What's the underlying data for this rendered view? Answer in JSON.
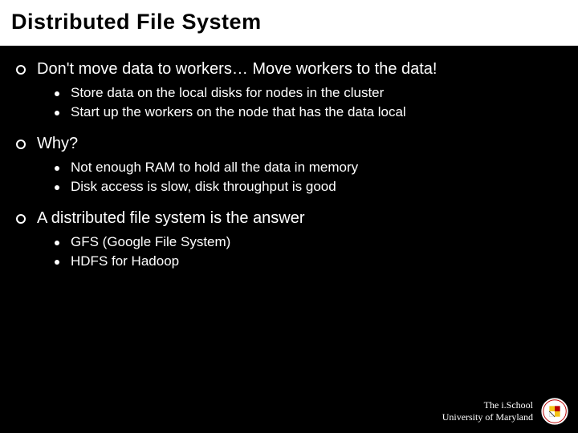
{
  "title": "Distributed File System",
  "sections": [
    {
      "heading": "Don't move data to workers… Move workers to the data!",
      "items": [
        "Store data on the local disks for nodes in the cluster",
        "Start up the workers on the node that has the data local"
      ]
    },
    {
      "heading": "Why?",
      "items": [
        "Not enough RAM to hold all the data in memory",
        "Disk access is slow, disk throughput is good"
      ]
    },
    {
      "heading": "A distributed file system is the answer",
      "items": [
        "GFS (Google File System)",
        "HDFS for Hadoop"
      ]
    }
  ],
  "footer": {
    "line1": "The i.School",
    "line2": "University of Maryland"
  }
}
